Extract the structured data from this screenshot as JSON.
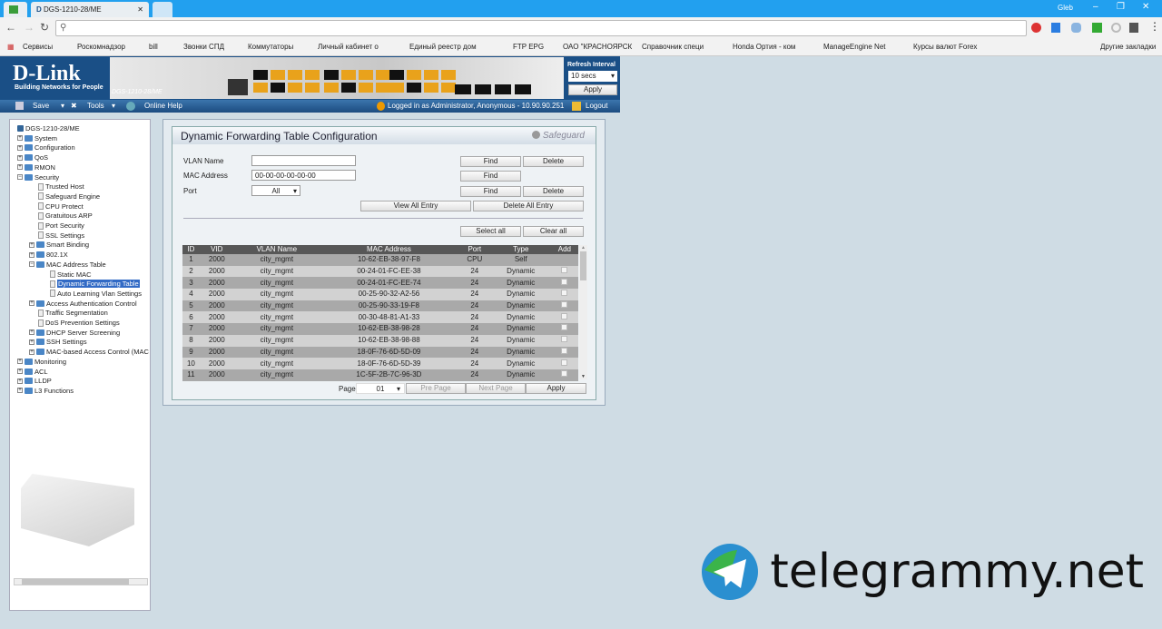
{
  "browser": {
    "tab_title": "DGS-1210-28/ME",
    "user": "Gleb",
    "address": "",
    "bookmarks": [
      "Сервисы",
      "Роскомнадзор",
      "bill",
      "Звонки СПД",
      "Коммутаторы",
      "Личный кабинет о",
      "Единый реестр дом",
      "FTP EPG",
      "ОАО \"КРАСНОЯРСК",
      "Справочник специ",
      "Honda Ортия - ком",
      "ManageEngine Net",
      "Курсы валют Forex",
      "Другие закладки"
    ]
  },
  "header": {
    "brand": "D-Link",
    "tagline": "Building Networks for People",
    "model": "DGS-1210-28/ME",
    "refresh_label": "Refresh Interval",
    "refresh_value": "10 secs",
    "apply": "Apply",
    "logout": "Logout"
  },
  "menu": {
    "save": "Save",
    "tools": "Tools",
    "help": "Online Help",
    "login_status": "Logged in as Administrator, Anonymous - 10.90.90.251"
  },
  "tree": [
    {
      "label": "DGS-1210-28/ME",
      "level": 0,
      "type": "root"
    },
    {
      "label": "System",
      "level": 0,
      "type": "folder"
    },
    {
      "label": "Configuration",
      "level": 0,
      "type": "folder"
    },
    {
      "label": "QoS",
      "level": 0,
      "type": "folder"
    },
    {
      "label": "RMON",
      "level": 0,
      "type": "folder"
    },
    {
      "label": "Security",
      "level": 0,
      "type": "folder",
      "open": true
    },
    {
      "label": "Trusted Host",
      "level": 1,
      "type": "doc"
    },
    {
      "label": "Safeguard Engine",
      "level": 1,
      "type": "doc"
    },
    {
      "label": "CPU Protect",
      "level": 1,
      "type": "doc"
    },
    {
      "label": "Gratuitous ARP",
      "level": 1,
      "type": "doc"
    },
    {
      "label": "Port Security",
      "level": 1,
      "type": "doc"
    },
    {
      "label": "SSL Settings",
      "level": 1,
      "type": "doc"
    },
    {
      "label": "Smart Binding",
      "level": 1,
      "type": "folder"
    },
    {
      "label": "802.1X",
      "level": 1,
      "type": "folder"
    },
    {
      "label": "MAC Address Table",
      "level": 1,
      "type": "folder",
      "open": true
    },
    {
      "label": "Static MAC",
      "level": 2,
      "type": "doc"
    },
    {
      "label": "Dynamic Forwarding Table",
      "level": 2,
      "type": "doc",
      "selected": true
    },
    {
      "label": "Auto Learning Vlan Settings",
      "level": 2,
      "type": "doc"
    },
    {
      "label": "Access Authentication Control",
      "level": 1,
      "type": "folder"
    },
    {
      "label": "Traffic Segmentation",
      "level": 1,
      "type": "doc"
    },
    {
      "label": "DoS Prevention Settings",
      "level": 1,
      "type": "doc"
    },
    {
      "label": "DHCP Server Screening",
      "level": 1,
      "type": "folder"
    },
    {
      "label": "SSH Settings",
      "level": 1,
      "type": "folder"
    },
    {
      "label": "MAC-based Access Control (MAC",
      "level": 1,
      "type": "folder"
    },
    {
      "label": "Monitoring",
      "level": 0,
      "type": "folder"
    },
    {
      "label": "ACL",
      "level": 0,
      "type": "folder"
    },
    {
      "label": "LLDP",
      "level": 0,
      "type": "folder"
    },
    {
      "label": "L3 Functions",
      "level": 0,
      "type": "folder"
    }
  ],
  "panel": {
    "title": "Dynamic Forwarding Table Configuration",
    "safeguard": "Safeguard",
    "vlan_label": "VLAN Name",
    "vlan_value": "",
    "mac_label": "MAC Address",
    "mac_value": "00-00-00-00-00-00",
    "port_label": "Port",
    "port_value": "All",
    "find": "Find",
    "delete": "Delete",
    "view_all": "View All Entry",
    "delete_all": "Delete All Entry",
    "select_all": "Select all",
    "clear_all": "Clear all",
    "columns": [
      "ID",
      "VID",
      "VLAN Name",
      "MAC Address",
      "Port",
      "Type",
      "Add"
    ],
    "rows": [
      [
        "1",
        "2000",
        "city_mgmt",
        "10-62-EB-38-97-F8",
        "CPU",
        "Self"
      ],
      [
        "2",
        "2000",
        "city_mgmt",
        "00-24-01-FC-EE-38",
        "24",
        "Dynamic"
      ],
      [
        "3",
        "2000",
        "city_mgmt",
        "00-24-01-FC-EE-74",
        "24",
        "Dynamic"
      ],
      [
        "4",
        "2000",
        "city_mgmt",
        "00-25-90-32-A2-56",
        "24",
        "Dynamic"
      ],
      [
        "5",
        "2000",
        "city_mgmt",
        "00-25-90-33-19-F8",
        "24",
        "Dynamic"
      ],
      [
        "6",
        "2000",
        "city_mgmt",
        "00-30-48-81-A1-33",
        "24",
        "Dynamic"
      ],
      [
        "7",
        "2000",
        "city_mgmt",
        "10-62-EB-38-98-28",
        "24",
        "Dynamic"
      ],
      [
        "8",
        "2000",
        "city_mgmt",
        "10-62-EB-38-98-88",
        "24",
        "Dynamic"
      ],
      [
        "9",
        "2000",
        "city_mgmt",
        "18-0F-76-6D-5D-09",
        "24",
        "Dynamic"
      ],
      [
        "10",
        "2000",
        "city_mgmt",
        "18-0F-76-6D-5D-39",
        "24",
        "Dynamic"
      ],
      [
        "11",
        "2000",
        "city_mgmt",
        "1C-5F-2B-7C-96-3D",
        "24",
        "Dynamic"
      ]
    ],
    "page_label": "Page",
    "page_value": "01",
    "pre_page": "Pre Page",
    "next_page": "Next Page",
    "apply": "Apply"
  },
  "watermark": "telegrammy.net"
}
